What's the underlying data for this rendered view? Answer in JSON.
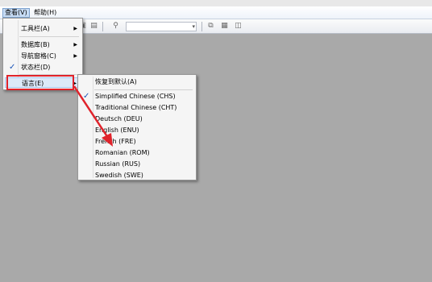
{
  "menubar": {
    "view": "查看(V)",
    "help": "帮助(H)"
  },
  "dropdown": {
    "items": [
      {
        "label": "工具栏(A)"
      },
      {
        "label": "数据库(B)"
      },
      {
        "label": "导航窗格(C)"
      },
      {
        "label": "状态栏(D)",
        "checked": "✓"
      },
      {
        "label": "语言(E)"
      }
    ]
  },
  "submenu": {
    "items": [
      {
        "label": "恢复到默认(A)"
      },
      {
        "label": "Simplified Chinese (CHS)",
        "checked": "✓"
      },
      {
        "label": "Traditional Chinese (CHT)"
      },
      {
        "label": "Deutsch (DEU)"
      },
      {
        "label": "English (ENU)"
      },
      {
        "label": "French (FRE)"
      },
      {
        "label": "Romanian (ROM)"
      },
      {
        "label": "Russian (RUS)"
      },
      {
        "label": "Swedish (SWE)"
      }
    ]
  },
  "colors": {
    "highlight": "#e0232b",
    "background": "#a9a9a9",
    "check": "#1a54b8"
  },
  "icons": [
    "dropdown-arrow-icon",
    "search-icon",
    "layout-icon",
    "check-icon",
    "submenu-arrow-icon"
  ]
}
